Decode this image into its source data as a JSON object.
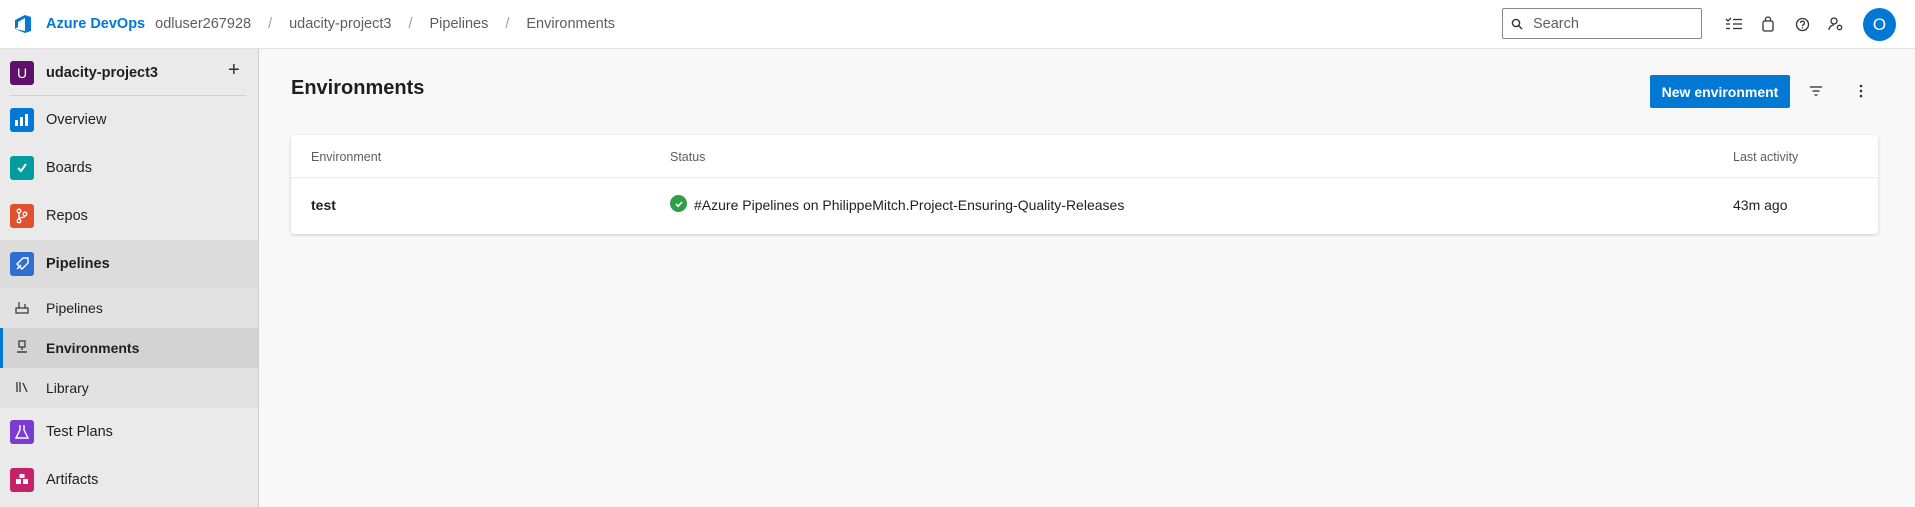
{
  "header": {
    "brand": "Azure DevOps",
    "breadcrumbs": [
      "odluser267928",
      "udacity-project3",
      "Pipelines",
      "Environments"
    ],
    "separator": "/",
    "search_placeholder": "Search",
    "avatar_initial": "O"
  },
  "sidebar": {
    "project_initial": "U",
    "project_name": "udacity-project3",
    "add_symbol": "+",
    "items": [
      {
        "label": "Overview",
        "color": "#0078d4"
      },
      {
        "label": "Boards",
        "color": "#009ca0"
      },
      {
        "label": "Repos",
        "color": "#e0512f"
      },
      {
        "label": "Pipelines",
        "color": "#2e6fd1"
      },
      {
        "label": "Test Plans",
        "color": "#7a3cd0"
      },
      {
        "label": "Artifacts",
        "color": "#c8216c"
      }
    ],
    "subitems": [
      {
        "label": "Pipelines"
      },
      {
        "label": "Environments"
      },
      {
        "label": "Library"
      }
    ]
  },
  "main": {
    "title": "Environments",
    "new_button": "New environment",
    "table": {
      "columns": [
        "Environment",
        "Status",
        "Last activity"
      ],
      "rows": [
        {
          "environment": "test",
          "status": "#Azure Pipelines on PhilippeMitch.Project-Ensuring-Quality-Releases",
          "last_activity": "43m ago",
          "status_color": "#2e9e4a"
        }
      ]
    }
  }
}
